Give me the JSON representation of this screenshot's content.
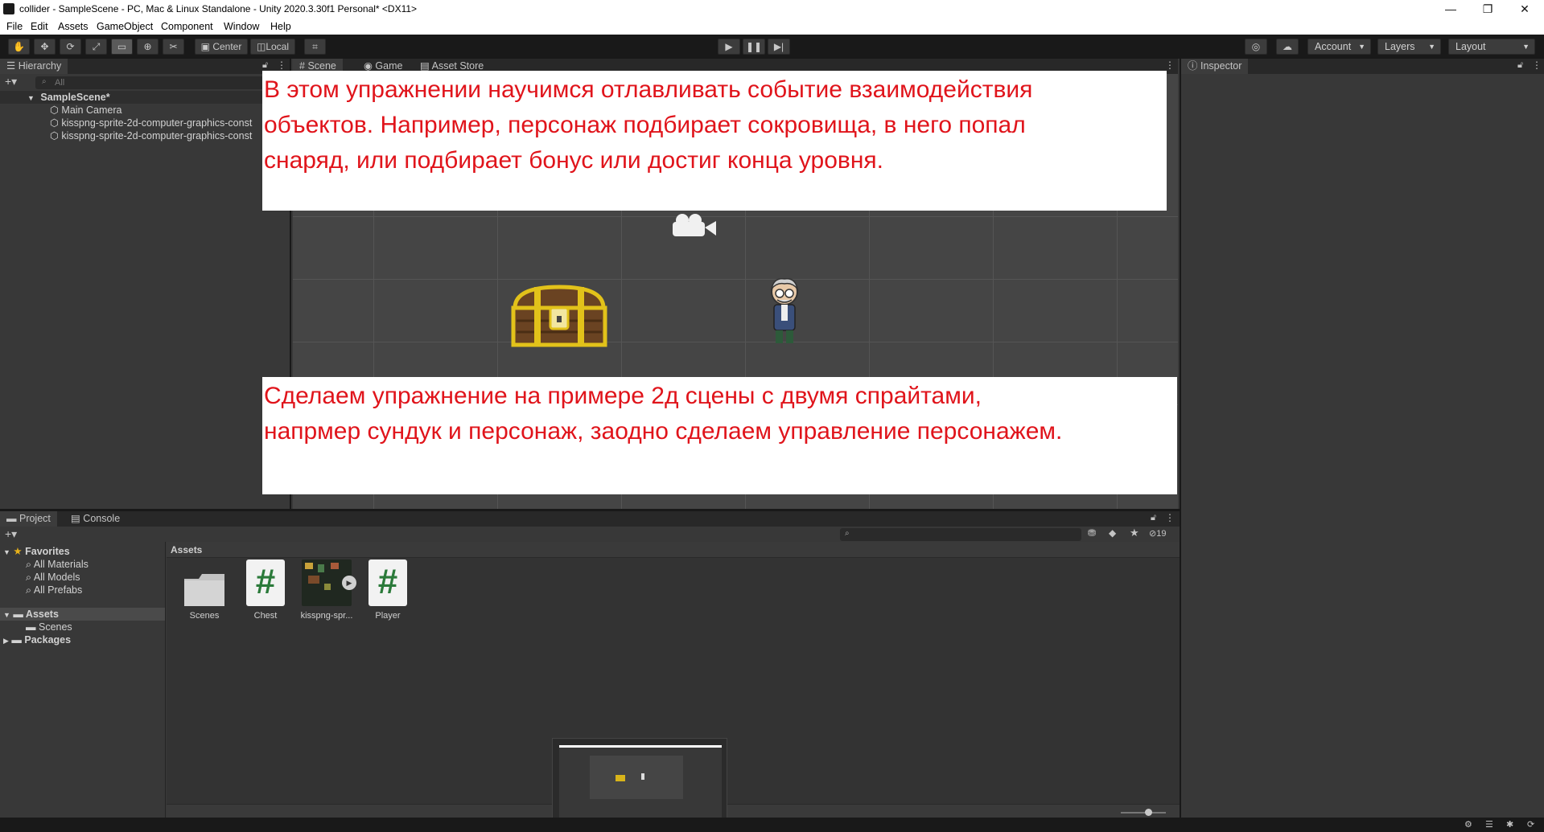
{
  "window": {
    "title": "collider - SampleScene - PC, Mac & Linux Standalone - Unity 2020.3.30f1 Personal* <DX11>",
    "minimize": "—",
    "restore": "❐",
    "close": "✕"
  },
  "menu": [
    "File",
    "Edit",
    "Assets",
    "GameObject",
    "Component",
    "Window",
    "Help"
  ],
  "toolbar": {
    "pivot": "Center",
    "space": "Local",
    "account": "Account",
    "layers": "Layers",
    "layout": "Layout"
  },
  "hierarchy": {
    "tab": "Hierarchy",
    "search_placeholder": "All",
    "scene": "SampleScene*",
    "items": [
      "Main Camera",
      "kisspng-sprite-2d-computer-graphics-const",
      "kisspng-sprite-2d-computer-graphics-const"
    ]
  },
  "scene_tabs": [
    "Scene",
    "Game",
    "Asset Store"
  ],
  "inspector": {
    "tab": "Inspector"
  },
  "project": {
    "tabs": [
      "Project",
      "Console"
    ],
    "favorites": "Favorites",
    "favorite_items": [
      "All Materials",
      "All Models",
      "All Prefabs"
    ],
    "assets_root": "Assets",
    "asset_folders": [
      "Scenes"
    ],
    "packages": "Packages",
    "breadcrumb": "Assets",
    "hidden_count": "19",
    "assets": [
      {
        "name": "Scenes",
        "kind": "folder"
      },
      {
        "name": "Chest",
        "kind": "script"
      },
      {
        "name": "kisspng-spr...",
        "kind": "sprite"
      },
      {
        "name": "Player",
        "kind": "script"
      }
    ]
  },
  "overlay_top": [
    "В этом упражнении научимся отлавливать событие взаимодействия",
    "объектов. Например, персонаж подбирает сокровища, в него попал",
    "снаряд, или подбирает бонус или достиг конца уровня."
  ],
  "overlay_bottom": [
    "Сделаем упражнение на примере 2д сцены с двумя спрайтами,",
    "напрмер сундук и персонаж, заодно сделаем управление персонажем."
  ]
}
